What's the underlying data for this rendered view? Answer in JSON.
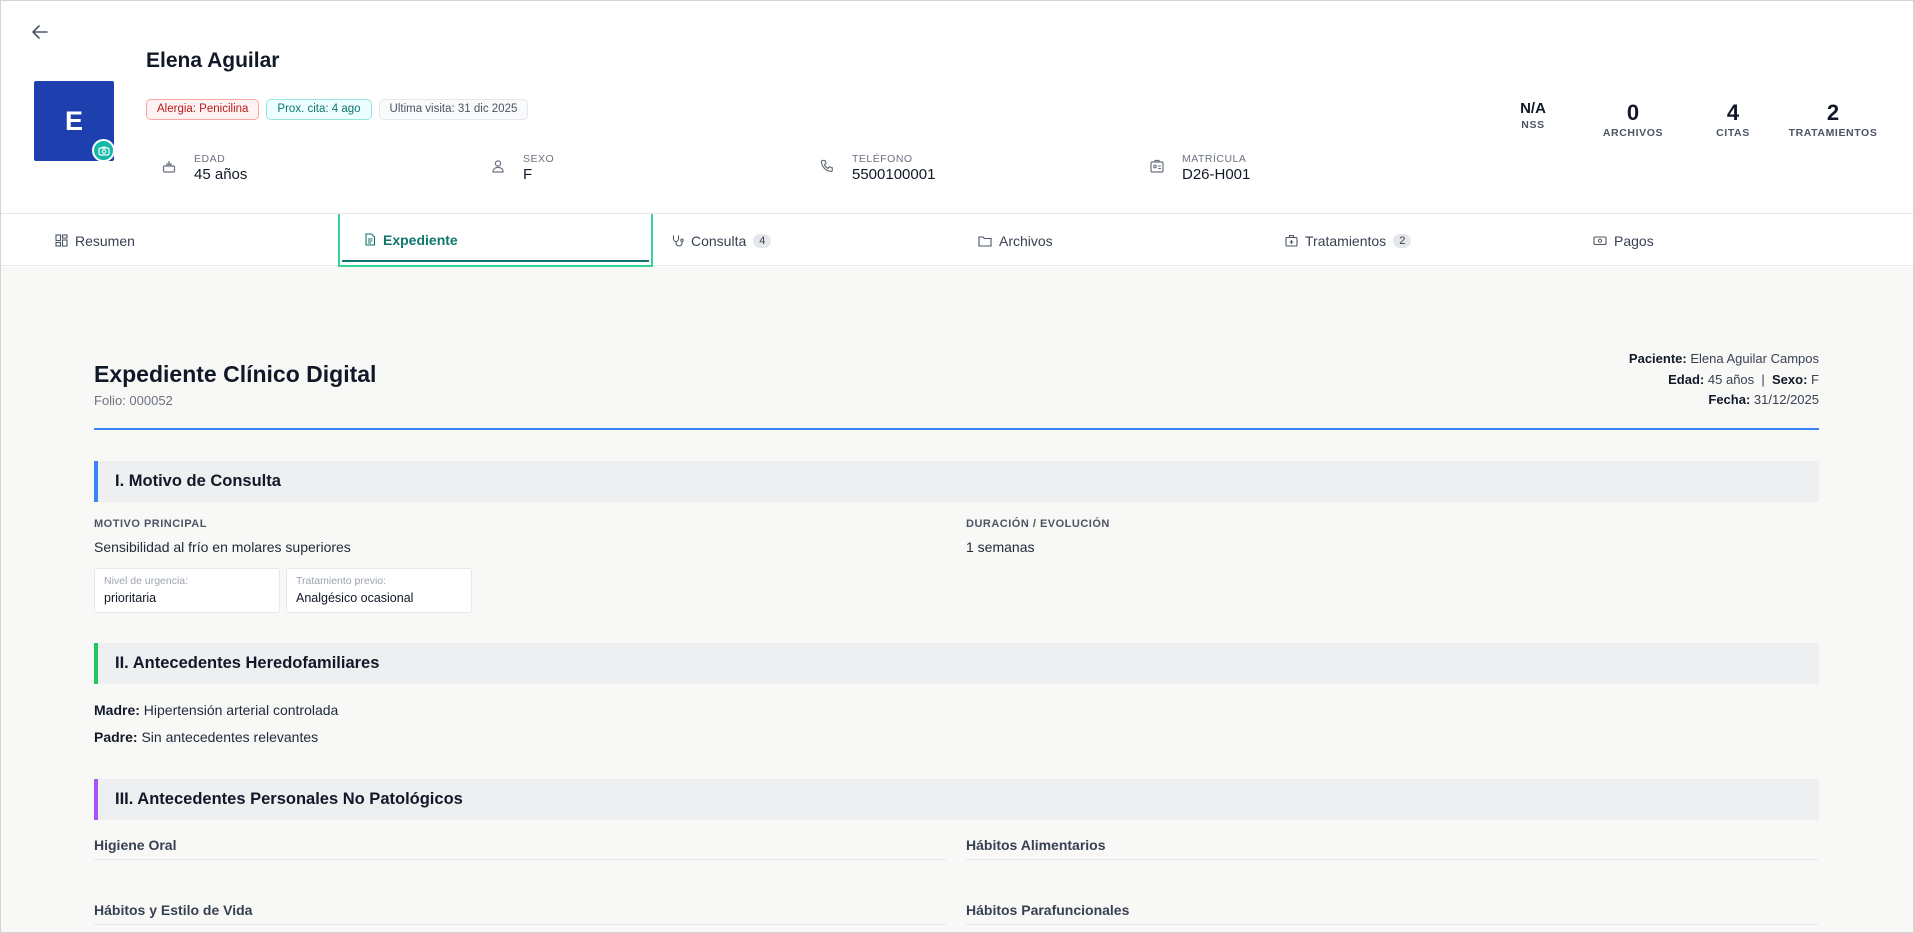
{
  "header": {
    "patient_name": "Elena Aguilar",
    "avatar_initial": "E",
    "badges": [
      {
        "label": "Alergia: Penicilina",
        "tone": "red"
      },
      {
        "label": "Prox. cita: 4 ago",
        "tone": "teal"
      },
      {
        "label": "Ultima visita: 31 dic 2025",
        "tone": "gray"
      }
    ],
    "info": [
      {
        "label": "EDAD",
        "value": "45 años",
        "icon": "cake-icon"
      },
      {
        "label": "SEXO",
        "value": "F",
        "icon": "user-icon"
      },
      {
        "label": "TELÉFONO",
        "value": "5500100001",
        "icon": "phone-icon"
      },
      {
        "label": "MATRÍCULA",
        "value": "D26-H001",
        "icon": "id-card-icon"
      }
    ],
    "stats": [
      {
        "value": "N/A",
        "label": "NSS"
      },
      {
        "value": "0",
        "label": "ARCHIVOS"
      },
      {
        "value": "4",
        "label": "CITAS"
      },
      {
        "value": "2",
        "label": "TRATAMIENTOS"
      }
    ]
  },
  "tabs": [
    {
      "label": "Resumen",
      "icon": "dashboard-icon",
      "count": null,
      "active": false
    },
    {
      "label": "Expediente",
      "icon": "document-icon",
      "count": null,
      "active": true
    },
    {
      "label": "Consulta",
      "icon": "stethoscope-icon",
      "count": "4",
      "active": false
    },
    {
      "label": "Archivos",
      "icon": "folder-icon",
      "count": null,
      "active": false
    },
    {
      "label": "Tratamientos",
      "icon": "medical-box-icon",
      "count": "2",
      "active": false
    },
    {
      "label": "Pagos",
      "icon": "cash-icon",
      "count": null,
      "active": false
    }
  ],
  "record": {
    "title": "Expediente Clínico Digital",
    "folio": "Folio: 000052",
    "meta": {
      "paciente_label": "Paciente:",
      "paciente_value": "Elena Aguilar Campos",
      "edad_label": "Edad:",
      "edad_value": "45 años",
      "separator": "|",
      "sexo_label": "Sexo:",
      "sexo_value": "F",
      "fecha_label": "Fecha:",
      "fecha_value": "31/12/2025"
    },
    "section1": {
      "title": "I. Motivo de Consulta",
      "motivo_label": "MOTIVO PRINCIPAL",
      "motivo_value": "Sensibilidad al frío en molares superiores",
      "duracion_label": "DURACIÓN / EVOLUCIÓN",
      "duracion_value": "1 semanas",
      "urgencia_label": "Nivel de urgencia:",
      "urgencia_value": "prioritaria",
      "tratamiento_label": "Tratamiento previo:",
      "tratamiento_value": "Analgésico ocasional"
    },
    "section2": {
      "title": "II. Antecedentes Heredofamiliares",
      "madre_label": "Madre:",
      "madre_value": "Hipertensión arterial controlada",
      "padre_label": "Padre:",
      "padre_value": "Sin antecedentes relevantes"
    },
    "section3": {
      "title": "III. Antecedentes Personales No Patológicos",
      "subsections": [
        "Higiene Oral",
        "Hábitos Alimentarios",
        "Hábitos y Estilo de Vida",
        "Hábitos Parafuncionales"
      ]
    }
  },
  "colors": {
    "avatar": "#1e40af",
    "accent_teal": "#0f766e",
    "rule_blue": "#3b82f6",
    "section1": "#3b82f6",
    "section2": "#22c55e",
    "section3": "#a855f7"
  }
}
